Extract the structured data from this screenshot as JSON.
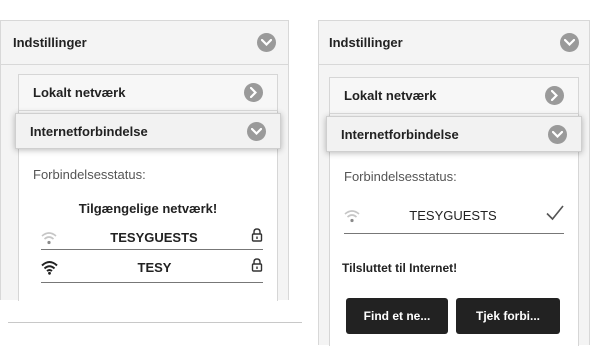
{
  "left": {
    "settings_title": "Indstillinger",
    "local_network_label": "Lokalt netværk",
    "internet_label": "Internetforbindelse",
    "status_label": "Forbindelsesstatus:",
    "available_label": "Tilgængelige netværk!",
    "networks": [
      {
        "ssid": "TESYGUESTS",
        "signal": "weak",
        "locked": true
      },
      {
        "ssid": "TESY",
        "signal": "strong",
        "locked": true
      }
    ]
  },
  "right": {
    "settings_title": "Indstillinger",
    "local_network_label": "Lokalt netværk",
    "internet_label": "Internetforbindelse",
    "status_label": "Forbindelsesstatus:",
    "current_network": {
      "ssid": "TESYGUESTS",
      "signal": "weak",
      "selected": true
    },
    "connected_text": "Tilsluttet til Internet!",
    "find_button": "Find et ne...",
    "check_button": "Tjek forbi..."
  },
  "colors": {
    "button_bg": "#222222",
    "icon_circle": "#9a9a9a",
    "panel_bg": "#f4f4f4"
  }
}
